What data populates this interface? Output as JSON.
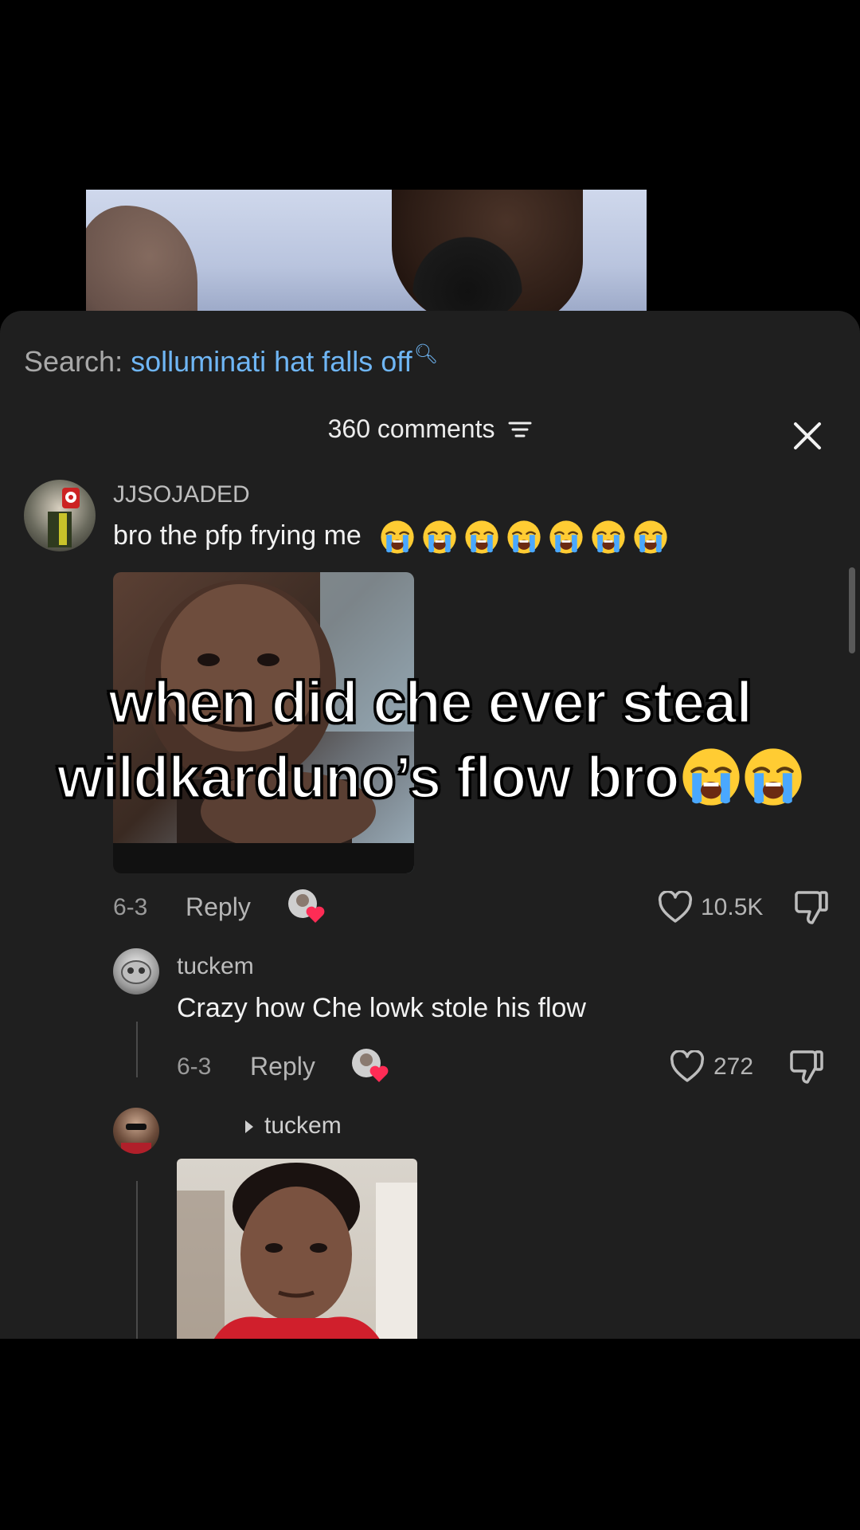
{
  "search": {
    "label": "Search:",
    "query": "solluminati hat falls off"
  },
  "comments_header": {
    "count_label": "360 comments"
  },
  "comments": [
    {
      "username": "JJSOJADED",
      "text": "bro the pfp frying me",
      "emoji_count": 7,
      "date": "6-3",
      "reply_label": "Reply",
      "likes": "10.5K"
    },
    {
      "username": "tuckem",
      "text": "Crazy how Che lowk stole his flow",
      "date": "6-3",
      "reply_label": "Reply",
      "likes": "272"
    },
    {
      "reply_to": "tuckem"
    }
  ],
  "caption": {
    "line1": "when did che ever steal",
    "line2": "wildkarduno’s flow bro"
  },
  "colors": {
    "sheet_bg": "#1f1f1f",
    "link_blue": "#6fb6f5",
    "heart_red": "#fe2c55"
  },
  "icons": [
    "search-icon",
    "sort-icon",
    "close-icon",
    "heart-icon",
    "dislike-icon",
    "crying-emoji",
    "play-triangle-icon"
  ]
}
